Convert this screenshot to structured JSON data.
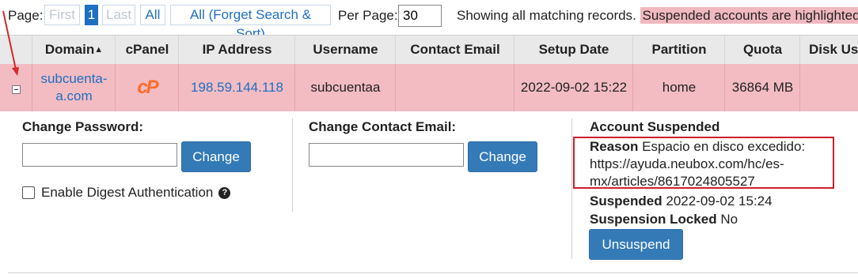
{
  "pagination": {
    "page_label": "Page:",
    "first": "First",
    "current": "1",
    "last": "Last",
    "all": "All",
    "all_forget": "All (Forget Search & Sort)",
    "per_page_label": "Per Page:",
    "per_page_value": "30"
  },
  "status": {
    "showing": "Showing all matching records.",
    "suspended_note": "Suspended accounts are highlighted"
  },
  "columns": {
    "domain": "Domain",
    "cpanel": "cPanel",
    "ip": "IP Address",
    "username": "Username",
    "contact_email": "Contact Email",
    "setup_date": "Setup Date",
    "partition": "Partition",
    "quota": "Quota",
    "disk_usage": "Disk Us"
  },
  "row": {
    "domain_line1": "subcuenta-",
    "domain_line2": "a.com",
    "cpanel_logo": "cP",
    "ip": "198.59.144.118",
    "username": "subcuentaa",
    "contact_email": "",
    "setup_date": "2022-09-02 15:22",
    "partition": "home",
    "quota": "36864 MB"
  },
  "details": {
    "change_password_label": "Change Password:",
    "change_password_button": "Change",
    "change_email_label": "Change Contact Email:",
    "change_email_button": "Change",
    "digest_label": "Enable Digest Authentication",
    "digest_checked": false,
    "suspended_title": "Account Suspended",
    "reason_label": "Reason",
    "reason_line1": "Espacio en disco excedido:",
    "reason_line2": "https://ayuda.neubox.com/hc/es-",
    "reason_line3": "mx/articles/8617024805527",
    "suspended_label": "Suspended",
    "suspended_value": "2022-09-02 15:24",
    "locked_label": "Suspension Locked",
    "locked_value": "No",
    "unsuspend_button": "Unsuspend"
  },
  "colors": {
    "accent": "#337ab7",
    "link": "#1f6fc2",
    "suspended_row": "#f2bcc2",
    "highlight_box": "#cc1f2d",
    "cpanel_logo": "#ff6c2c"
  },
  "icons": [
    "sort-ascending-icon",
    "collapse-icon",
    "cpanel-logo-icon",
    "help-icon",
    "annotation-arrow-icon"
  ]
}
